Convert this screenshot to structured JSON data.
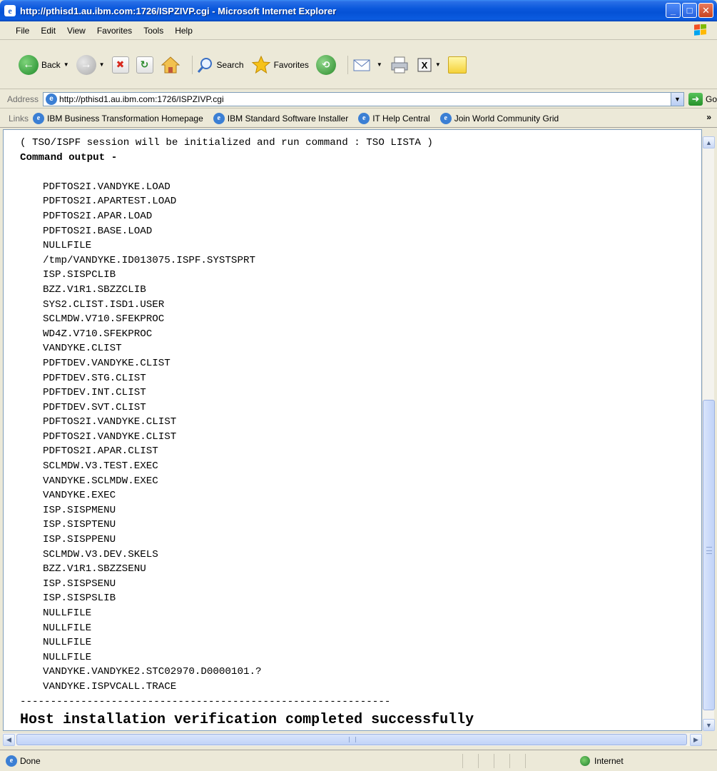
{
  "window": {
    "title": "http://pthisd1.au.ibm.com:1726/ISPZIVP.cgi - Microsoft Internet Explorer",
    "minimize": "_",
    "maximize": "□",
    "close": "✕"
  },
  "menu": {
    "items": [
      "File",
      "Edit",
      "View",
      "Favorites",
      "Tools",
      "Help"
    ]
  },
  "toolbar": {
    "back_label": "Back",
    "search_label": "Search",
    "favorites_label": "Favorites"
  },
  "address": {
    "label": "Address",
    "url": "http://pthisd1.au.ibm.com:1726/ISPZIVP.cgi",
    "go_label": "Go"
  },
  "links": {
    "label": "Links",
    "items": [
      "IBM Business Transformation Homepage",
      "IBM Standard Software Installer",
      "IT Help Central",
      "Join World Community Grid"
    ],
    "more": "»"
  },
  "content": {
    "intro": "( TSO/ISPF session will be initialized and run command : TSO LISTA )",
    "command_output_label": "Command output -",
    "datasets": [
      "PDFTOS2I.VANDYKE.LOAD",
      "PDFTOS2I.APARTEST.LOAD",
      "PDFTOS2I.APAR.LOAD",
      "PDFTOS2I.BASE.LOAD",
      "NULLFILE",
      "/tmp/VANDYKE.ID013075.ISPF.SYSTSPRT",
      "ISP.SISPCLIB",
      "BZZ.V1R1.SBZZCLIB",
      "SYS2.CLIST.ISD1.USER",
      "SCLMDW.V710.SFEKPROC",
      "WD4Z.V710.SFEKPROC",
      "VANDYKE.CLIST",
      "PDFTDEV.VANDYKE.CLIST",
      "PDFTDEV.STG.CLIST",
      "PDFTDEV.INT.CLIST",
      "PDFTDEV.SVT.CLIST",
      "PDFTOS2I.VANDYKE.CLIST",
      "PDFTOS2I.VANDYKE.CLIST",
      "PDFTOS2I.APAR.CLIST",
      "SCLMDW.V3.TEST.EXEC",
      "VANDYKE.SCLMDW.EXEC",
      "VANDYKE.EXEC",
      "ISP.SISPMENU",
      "ISP.SISPTENU",
      "ISP.SISPPENU",
      "SCLMDW.V3.DEV.SKELS",
      "BZZ.V1R1.SBZZSENU",
      "ISP.SISPSENU",
      "ISP.SISPSLIB",
      "NULLFILE",
      "NULLFILE",
      "NULLFILE",
      "NULLFILE",
      "VANDYKE.VANDYKE2.STC02970.D0000101.?",
      "VANDYKE.ISPVCALL.TRACE"
    ],
    "divider": "-------------------------------------------------------------",
    "success_message": "Host installation verification completed successfully"
  },
  "status": {
    "text": "Done",
    "zone": "Internet"
  }
}
